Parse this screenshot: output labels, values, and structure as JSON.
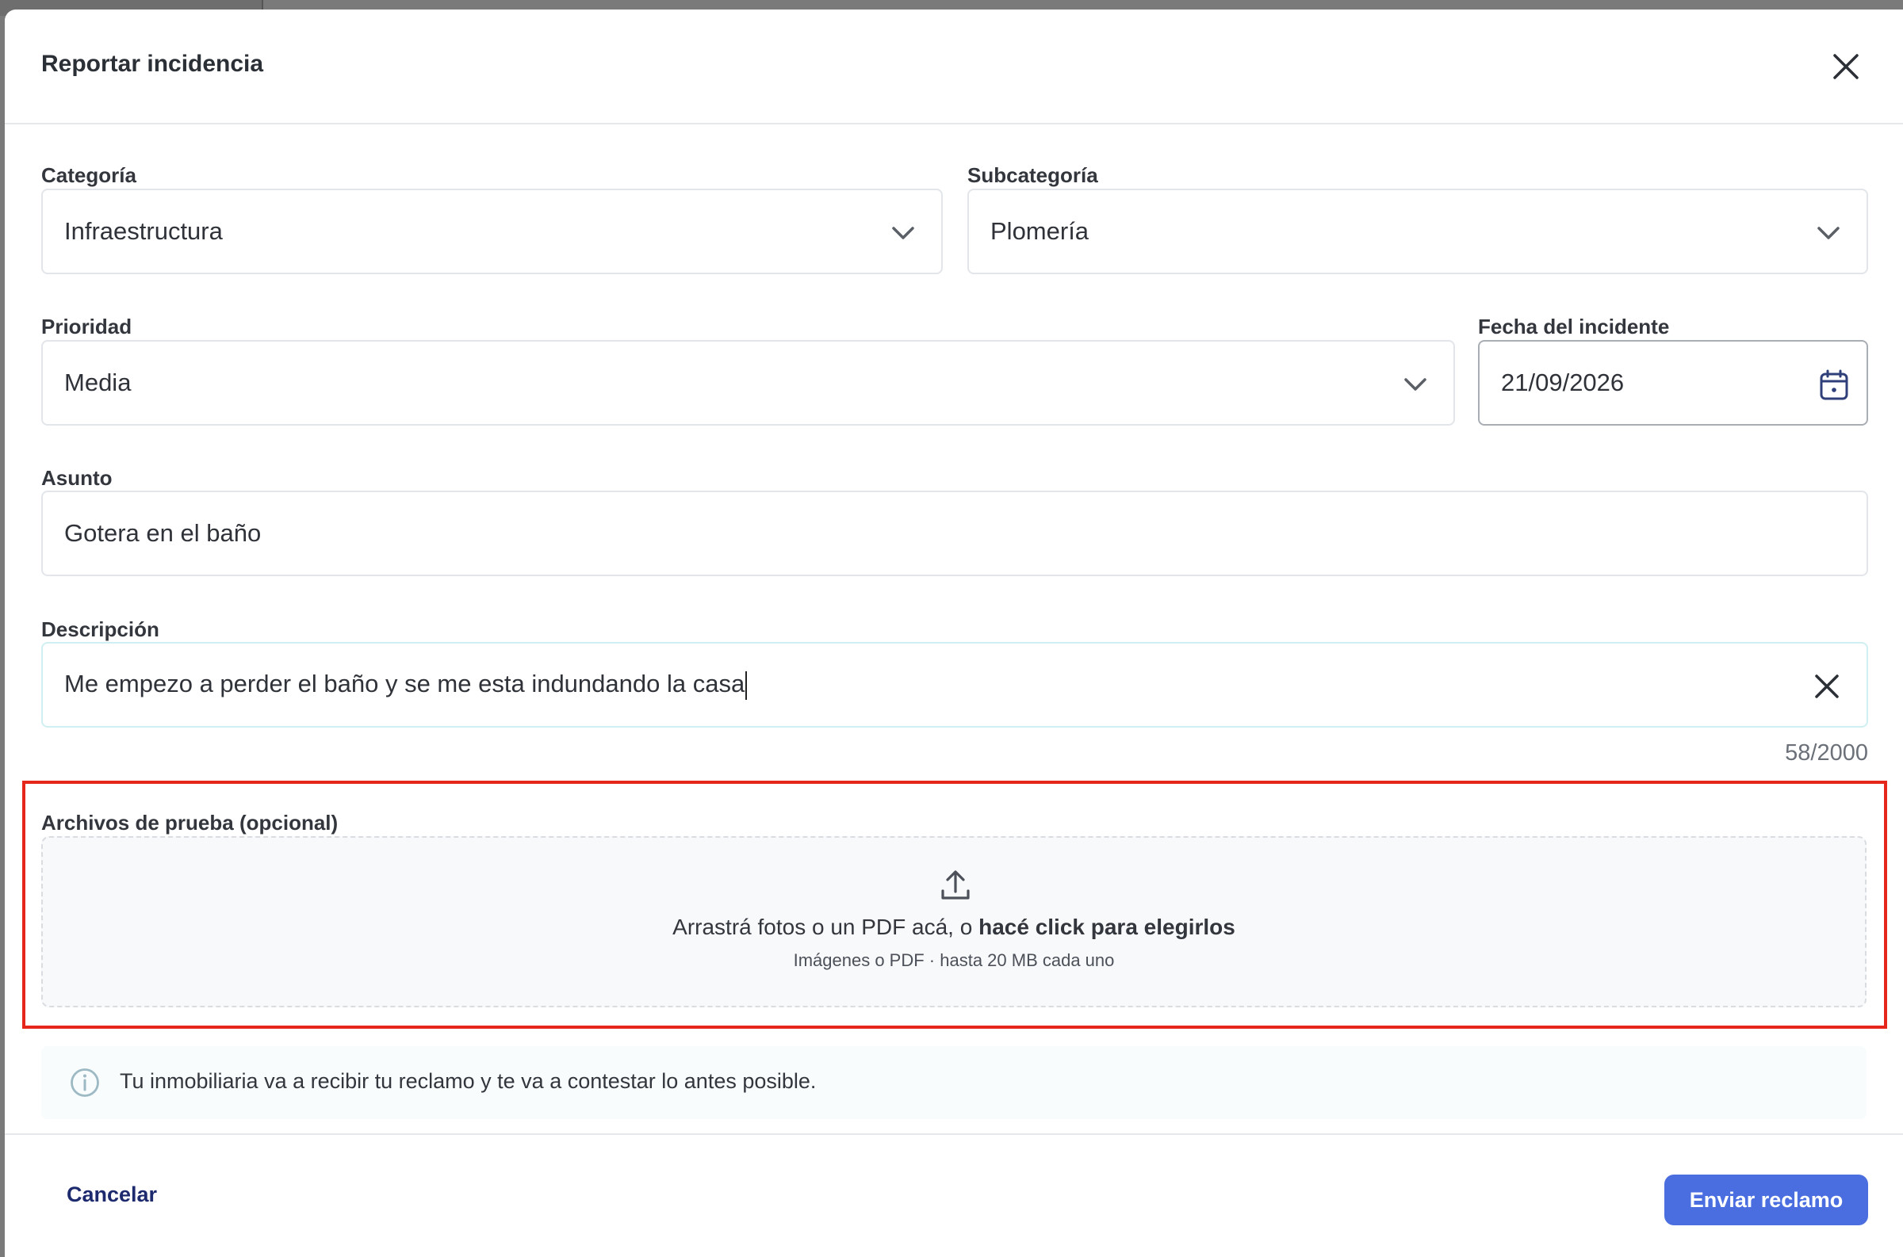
{
  "dialog": {
    "title": "Reportar incidencia",
    "close_icon": "close-icon"
  },
  "form": {
    "categoria": {
      "label": "Categoría",
      "value": "Infraestructura"
    },
    "subcategoria": {
      "label": "Subcategoría",
      "value": "Plomería"
    },
    "prioridad": {
      "label": "Prioridad",
      "value": "Media"
    },
    "fecha": {
      "label": "Fecha del incidente",
      "value": "21/09/2026",
      "icon": "calendar-icon"
    },
    "asunto": {
      "label": "Asunto",
      "value": "Gotera en el baño"
    },
    "descripcion": {
      "label": "Descripción",
      "value": "Me empezo a perder el baño y se me esta indundando la casa",
      "counter": "58/2000"
    }
  },
  "attachments": {
    "label": "Archivos de prueba (opcional)",
    "drop_text": "Arrastrá fotos o un PDF acá, o ",
    "drop_link": "hacé click para elegirlos",
    "hint": "Imágenes o PDF · hasta 20 MB cada uno",
    "icon": "upload-icon"
  },
  "info": {
    "text": "Tu inmobiliaria va a recibir tu reclamo y te va a contestar lo antes posible.",
    "icon": "info-icon"
  },
  "footer": {
    "cancel_label": "Cancelar",
    "submit_label": "Enviar reclamo"
  },
  "colors": {
    "primary_button": "#4a6ee0",
    "cancel_text": "#1e2a6e",
    "highlight_border": "#e4261b"
  }
}
